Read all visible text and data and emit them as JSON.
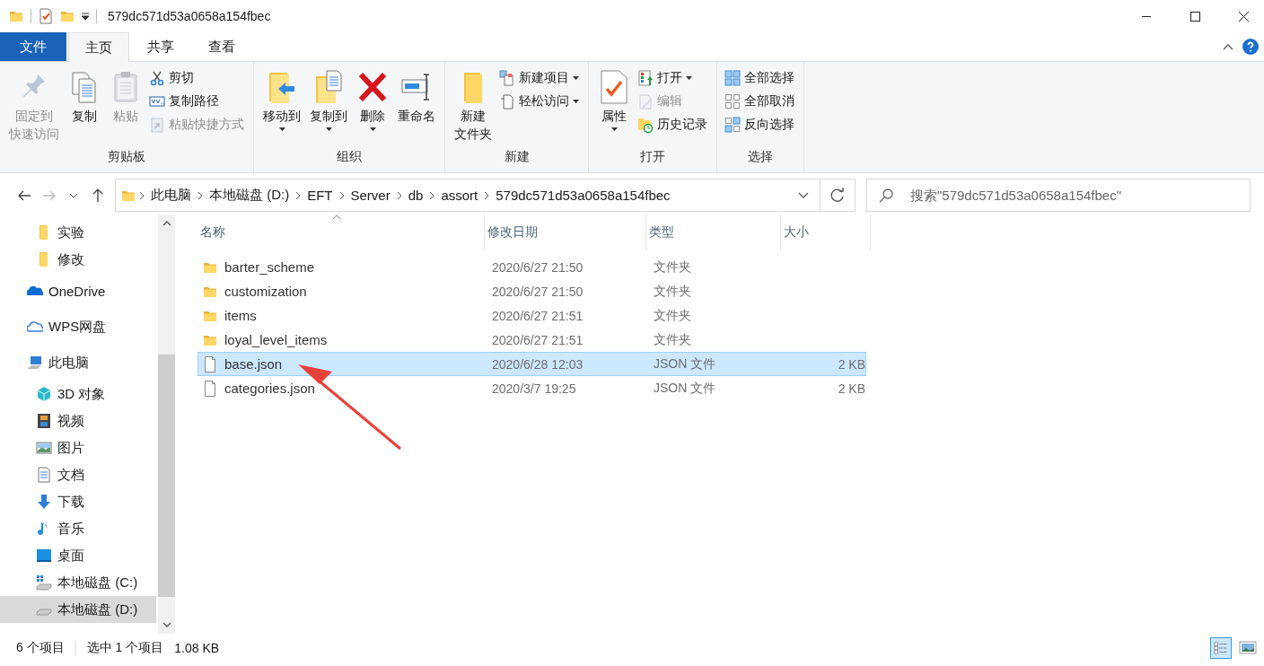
{
  "window": {
    "title": "579dc571d53a0658a154fbec"
  },
  "ribbon_tabs": [
    {
      "label": "文件",
      "kind": "file",
      "selected": false
    },
    {
      "label": "主页",
      "kind": "tab",
      "selected": true
    },
    {
      "label": "共享",
      "kind": "tab",
      "selected": false
    },
    {
      "label": "查看",
      "kind": "tab",
      "selected": false
    }
  ],
  "ribbon_groups": [
    {
      "label": "剪贴板",
      "columns": [
        {
          "kind": "large",
          "lines": [
            "固定到",
            "快速访问"
          ],
          "disabled": true,
          "dropdown": false
        },
        {
          "kind": "large",
          "lines": [
            "复制"
          ],
          "disabled": false,
          "dropdown": false
        },
        {
          "kind": "large",
          "lines": [
            "粘贴"
          ],
          "disabled": true,
          "dropdown": false
        },
        {
          "kind": "stack",
          "items": [
            {
              "label": "剪切",
              "disabled": false,
              "dropdown": false
            },
            {
              "label": "复制路径",
              "disabled": false,
              "dropdown": false
            },
            {
              "label": "粘贴快捷方式",
              "disabled": true,
              "dropdown": false
            }
          ]
        }
      ]
    },
    {
      "label": "组织",
      "columns": [
        {
          "kind": "large",
          "lines": [
            "移动到"
          ],
          "disabled": false,
          "dropdown": true
        },
        {
          "kind": "large",
          "lines": [
            "复制到"
          ],
          "disabled": false,
          "dropdown": true
        },
        {
          "kind": "large",
          "lines": [
            "删除"
          ],
          "disabled": false,
          "dropdown": true
        },
        {
          "kind": "large",
          "lines": [
            "重命名"
          ],
          "disabled": false,
          "dropdown": false
        }
      ]
    },
    {
      "label": "新建",
      "columns": [
        {
          "kind": "large",
          "lines": [
            "新建",
            "文件夹"
          ],
          "disabled": false,
          "dropdown": false
        },
        {
          "kind": "stack",
          "items": [
            {
              "label": "新建项目",
              "disabled": false,
              "dropdown": true
            },
            {
              "label": "轻松访问",
              "disabled": false,
              "dropdown": true
            }
          ]
        }
      ]
    },
    {
      "label": "打开",
      "columns": [
        {
          "kind": "large",
          "lines": [
            "属性"
          ],
          "disabled": false,
          "dropdown": true
        },
        {
          "kind": "stack",
          "items": [
            {
              "label": "打开",
              "disabled": false,
              "dropdown": true
            },
            {
              "label": "编辑",
              "disabled": true,
              "dropdown": false
            },
            {
              "label": "历史记录",
              "disabled": false,
              "dropdown": false
            }
          ]
        }
      ]
    },
    {
      "label": "选择",
      "columns": [
        {
          "kind": "stack",
          "items": [
            {
              "label": "全部选择",
              "disabled": false,
              "dropdown": false
            },
            {
              "label": "全部取消",
              "disabled": false,
              "dropdown": false
            },
            {
              "label": "反向选择",
              "disabled": false,
              "dropdown": false
            }
          ]
        }
      ]
    }
  ],
  "address": {
    "breadcrumbs": [
      "此电脑",
      "本地磁盘 (D:)",
      "EFT",
      "Server",
      "db",
      "assort",
      "579dc571d53a0658a154fbec"
    ]
  },
  "search": {
    "placeholder": "搜索\"579dc571d53a0658a154fbec\""
  },
  "sidebar": {
    "items": [
      {
        "label": "实验",
        "selected": false
      },
      {
        "label": "修改",
        "selected": false
      },
      {
        "label": "OneDrive",
        "selected": false
      },
      {
        "label": "WPS网盘",
        "selected": false
      },
      {
        "label": "此电脑",
        "selected": false,
        "children": [
          {
            "label": "3D 对象",
            "selected": false
          },
          {
            "label": "视频",
            "selected": false
          },
          {
            "label": "图片",
            "selected": false
          },
          {
            "label": "文档",
            "selected": false
          },
          {
            "label": "下载",
            "selected": false
          },
          {
            "label": "音乐",
            "selected": false
          },
          {
            "label": "桌面",
            "selected": false
          },
          {
            "label": "本地磁盘 (C:)",
            "selected": false
          },
          {
            "label": "本地磁盘 (D:)",
            "selected": true
          }
        ]
      }
    ]
  },
  "table": {
    "columns": [
      {
        "label": "名称",
        "sorted": true
      },
      {
        "label": "修改日期",
        "sorted": false
      },
      {
        "label": "类型",
        "sorted": false
      },
      {
        "label": "大小",
        "sorted": false
      }
    ],
    "rows": [
      {
        "kind": "folder",
        "name": "barter_scheme",
        "date": "2020/6/27 21:50",
        "type": "文件夹",
        "selected": false
      },
      {
        "kind": "folder",
        "name": "customization",
        "date": "2020/6/27 21:50",
        "type": "文件夹",
        "selected": false
      },
      {
        "kind": "folder",
        "name": "items",
        "date": "2020/6/27 21:51",
        "type": "文件夹",
        "selected": false
      },
      {
        "kind": "folder",
        "name": "loyal_level_items",
        "date": "2020/6/27 21:51",
        "type": "文件夹",
        "selected": false
      },
      {
        "kind": "file",
        "name": "base.json",
        "date": "2020/6/28 12:03",
        "type": "JSON 文件",
        "size": "2 KB",
        "selected": true
      },
      {
        "kind": "file",
        "name": "categories.json",
        "date": "2020/3/7 19:25",
        "type": "JSON 文件",
        "size": "2 KB",
        "selected": false
      }
    ]
  },
  "status_bar": {
    "count": "6 个项目",
    "selection": "选中 1 个项目",
    "size": "1.08 KB"
  },
  "view_buttons": [
    {
      "selected": true
    },
    {
      "selected": false
    }
  ]
}
